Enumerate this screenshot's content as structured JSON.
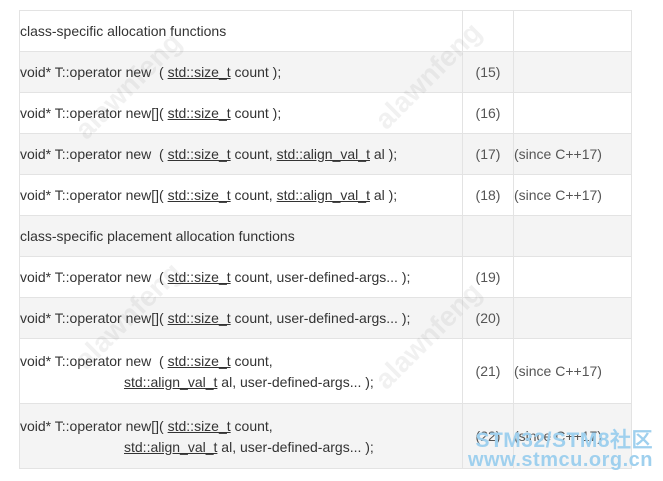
{
  "table": {
    "rows": [
      {
        "kind": "header",
        "text": "class-specific allocation functions"
      },
      {
        "kind": "sig",
        "prefix": "void* T::operator new",
        "gap": "  ( ",
        "parts": [
          [
            "u",
            "std::size_t"
          ],
          [
            "t",
            " count );"
          ]
        ],
        "num": "(15)",
        "since": ""
      },
      {
        "kind": "sig",
        "prefix": "void* T::operator new[]",
        "gap": "( ",
        "parts": [
          [
            "u",
            "std::size_t"
          ],
          [
            "t",
            " count );"
          ]
        ],
        "num": "(16)",
        "since": ""
      },
      {
        "kind": "sig",
        "prefix": "void* T::operator new",
        "gap": "  ( ",
        "parts": [
          [
            "u",
            "std::size_t"
          ],
          [
            "t",
            " count, "
          ],
          [
            "u",
            "std::align_val_t"
          ],
          [
            "t",
            " al );"
          ]
        ],
        "num": "(17)",
        "since": "(since C++17)"
      },
      {
        "kind": "sig",
        "prefix": "void* T::operator new[]",
        "gap": "( ",
        "parts": [
          [
            "u",
            "std::size_t"
          ],
          [
            "t",
            " count, "
          ],
          [
            "u",
            "std::align_val_t"
          ],
          [
            "t",
            " al );"
          ]
        ],
        "num": "(18)",
        "since": "(since C++17)"
      },
      {
        "kind": "header",
        "text": "class-specific placement allocation functions"
      },
      {
        "kind": "sig",
        "prefix": "void* T::operator new",
        "gap": "  ( ",
        "parts": [
          [
            "u",
            "std::size_t"
          ],
          [
            "t",
            " count, user-defined-args... );"
          ]
        ],
        "num": "(19)",
        "since": ""
      },
      {
        "kind": "sig",
        "prefix": "void* T::operator new[]",
        "gap": "( ",
        "parts": [
          [
            "u",
            "std::size_t"
          ],
          [
            "t",
            " count, user-defined-args... );"
          ]
        ],
        "num": "(20)",
        "since": ""
      },
      {
        "kind": "sig2",
        "prefix": "void* T::operator new",
        "gap": "  ( ",
        "parts": [
          [
            "u",
            "std::size_t"
          ],
          [
            "t",
            " count,"
          ]
        ],
        "parts2": [
          [
            "u",
            "std::align_val_t"
          ],
          [
            "t",
            " al, user-defined-args... );"
          ]
        ],
        "num": "(21)",
        "since": "(since C++17)"
      },
      {
        "kind": "sig2",
        "prefix": "void* T::operator new[]",
        "gap": "( ",
        "parts": [
          [
            "u",
            "std::size_t"
          ],
          [
            "t",
            " count,"
          ]
        ],
        "parts2": [
          [
            "u",
            "std::align_val_t"
          ],
          [
            "t",
            " al, user-defined-args... );"
          ]
        ],
        "num": "(22)",
        "since": "(since C++17)"
      }
    ]
  },
  "watermark": {
    "text": "alawnfeng"
  },
  "site_logo": {
    "line1": "STM32/STM8社区",
    "line2": "www.stmcu.org.cn",
    "color": "#9fd0ee"
  }
}
